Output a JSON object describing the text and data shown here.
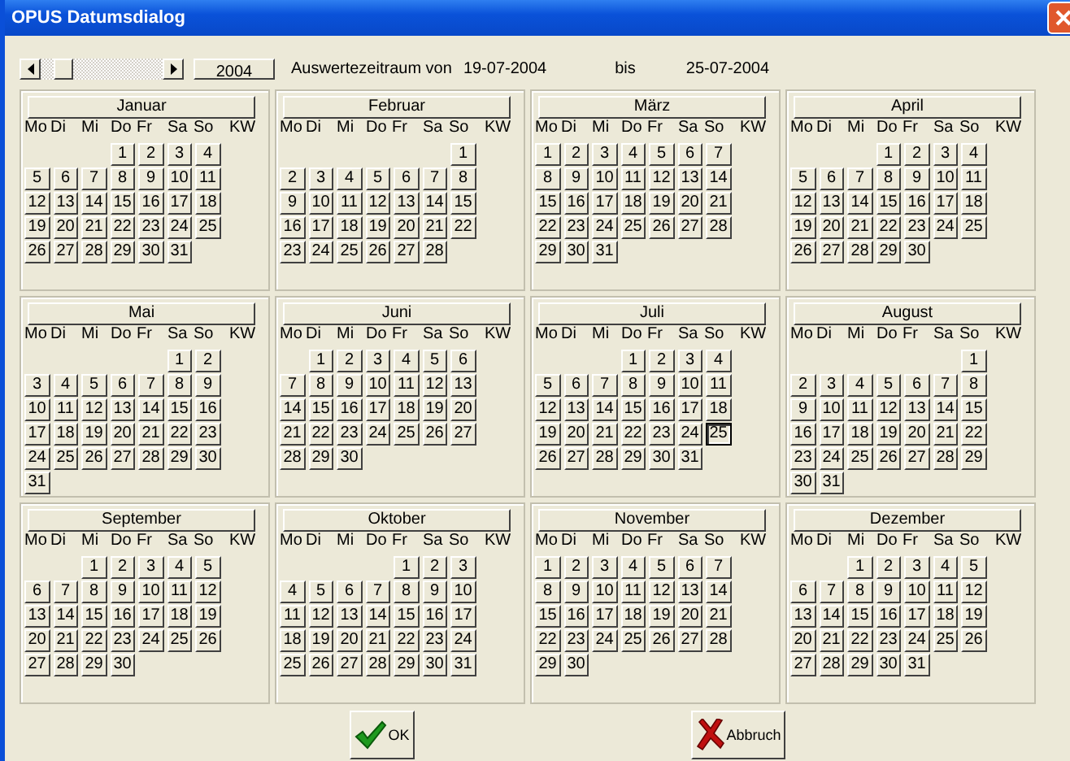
{
  "window": {
    "title": "OPUS Datumsdialog"
  },
  "year_button": "2004",
  "range": {
    "from_label": "Auswertezeitraum von",
    "from": "19-07-2004",
    "to_label": "bis",
    "to": "25-07-2004"
  },
  "months": [
    {
      "name": "Januar",
      "weekdays": [
        "Mo",
        "Di",
        "Mi",
        "Do",
        "Fr",
        "Sa",
        "So",
        "KW"
      ],
      "weeks": [
        [
          {
            "t": "1",
            "selected": false
          },
          {
            "t": "2",
            "selected": false
          },
          {
            "t": "3",
            "selected": false
          },
          {
            "t": "4",
            "selected": false
          }
        ],
        [
          {
            "t": "5",
            "selected": false
          },
          {
            "t": "6",
            "selected": false
          },
          {
            "t": "7",
            "selected": false
          },
          {
            "t": "8",
            "selected": false
          },
          {
            "t": "9",
            "selected": false
          },
          {
            "t": "10",
            "selected": false
          },
          {
            "t": "11",
            "selected": false
          }
        ],
        [
          {
            "t": "12",
            "selected": false
          },
          {
            "t": "13",
            "selected": false
          },
          {
            "t": "14",
            "selected": false
          },
          {
            "t": "15",
            "selected": false
          },
          {
            "t": "16",
            "selected": false
          },
          {
            "t": "17",
            "selected": false
          },
          {
            "t": "18",
            "selected": false
          }
        ],
        [
          {
            "t": "19",
            "selected": false
          },
          {
            "t": "20",
            "selected": false
          },
          {
            "t": "21",
            "selected": false
          },
          {
            "t": "22",
            "selected": false
          },
          {
            "t": "23",
            "selected": false
          },
          {
            "t": "24",
            "selected": false
          },
          {
            "t": "25",
            "selected": false
          }
        ],
        [
          {
            "t": "26",
            "selected": false
          },
          {
            "t": "27",
            "selected": false
          },
          {
            "t": "28",
            "selected": false
          },
          {
            "t": "29",
            "selected": false
          },
          {
            "t": "30",
            "selected": false
          },
          {
            "t": "31",
            "selected": false
          }
        ]
      ]
    },
    {
      "name": "Februar",
      "weekdays": [
        "Mo",
        "Di",
        "Mi",
        "Do",
        "Fr",
        "Sa",
        "So",
        "KW"
      ],
      "weeks": [
        [
          {
            "t": "1",
            "selected": false
          }
        ],
        [
          {
            "t": "2",
            "selected": false
          },
          {
            "t": "3",
            "selected": false
          },
          {
            "t": "4",
            "selected": false
          },
          {
            "t": "5",
            "selected": false
          },
          {
            "t": "6",
            "selected": false
          },
          {
            "t": "7",
            "selected": false
          },
          {
            "t": "8",
            "selected": false
          }
        ],
        [
          {
            "t": "9",
            "selected": false
          },
          {
            "t": "10",
            "selected": false
          },
          {
            "t": "11",
            "selected": false
          },
          {
            "t": "12",
            "selected": false
          },
          {
            "t": "13",
            "selected": false
          },
          {
            "t": "14",
            "selected": false
          },
          {
            "t": "15",
            "selected": false
          }
        ],
        [
          {
            "t": "16",
            "selected": false
          },
          {
            "t": "17",
            "selected": false
          },
          {
            "t": "18",
            "selected": false
          },
          {
            "t": "19",
            "selected": false
          },
          {
            "t": "20",
            "selected": false
          },
          {
            "t": "21",
            "selected": false
          },
          {
            "t": "22",
            "selected": false
          }
        ],
        [
          {
            "t": "23",
            "selected": false
          },
          {
            "t": "24",
            "selected": false
          },
          {
            "t": "25",
            "selected": false
          },
          {
            "t": "26",
            "selected": false
          },
          {
            "t": "27",
            "selected": false
          },
          {
            "t": "28",
            "selected": false
          }
        ]
      ]
    },
    {
      "name": "März",
      "weekdays": [
        "Mo",
        "Di",
        "Mi",
        "Do",
        "Fr",
        "Sa",
        "So",
        "KW"
      ],
      "weeks": [
        [
          {
            "t": "1",
            "selected": false
          },
          {
            "t": "2",
            "selected": false
          },
          {
            "t": "3",
            "selected": false
          },
          {
            "t": "4",
            "selected": false
          },
          {
            "t": "5",
            "selected": false
          },
          {
            "t": "6",
            "selected": false
          },
          {
            "t": "7",
            "selected": false
          }
        ],
        [
          {
            "t": "8",
            "selected": false
          },
          {
            "t": "9",
            "selected": false
          },
          {
            "t": "10",
            "selected": false
          },
          {
            "t": "11",
            "selected": false
          },
          {
            "t": "12",
            "selected": false
          },
          {
            "t": "13",
            "selected": false
          },
          {
            "t": "14",
            "selected": false
          }
        ],
        [
          {
            "t": "15",
            "selected": false
          },
          {
            "t": "16",
            "selected": false
          },
          {
            "t": "17",
            "selected": false
          },
          {
            "t": "18",
            "selected": false
          },
          {
            "t": "19",
            "selected": false
          },
          {
            "t": "20",
            "selected": false
          },
          {
            "t": "21",
            "selected": false
          }
        ],
        [
          {
            "t": "22",
            "selected": false
          },
          {
            "t": "23",
            "selected": false
          },
          {
            "t": "24",
            "selected": false
          },
          {
            "t": "25",
            "selected": false
          },
          {
            "t": "26",
            "selected": false
          },
          {
            "t": "27",
            "selected": false
          },
          {
            "t": "28",
            "selected": false
          }
        ],
        [
          {
            "t": "29",
            "selected": false
          },
          {
            "t": "30",
            "selected": false
          },
          {
            "t": "31",
            "selected": false
          }
        ]
      ]
    },
    {
      "name": "April",
      "weekdays": [
        "Mo",
        "Di",
        "Mi",
        "Do",
        "Fr",
        "Sa",
        "So",
        "KW"
      ],
      "weeks": [
        [
          {
            "t": "1",
            "selected": false
          },
          {
            "t": "2",
            "selected": false
          },
          {
            "t": "3",
            "selected": false
          },
          {
            "t": "4",
            "selected": false
          }
        ],
        [
          {
            "t": "5",
            "selected": false
          },
          {
            "t": "6",
            "selected": false
          },
          {
            "t": "7",
            "selected": false
          },
          {
            "t": "8",
            "selected": false
          },
          {
            "t": "9",
            "selected": false
          },
          {
            "t": "10",
            "selected": false
          },
          {
            "t": "11",
            "selected": false
          }
        ],
        [
          {
            "t": "12",
            "selected": false
          },
          {
            "t": "13",
            "selected": false
          },
          {
            "t": "14",
            "selected": false
          },
          {
            "t": "15",
            "selected": false
          },
          {
            "t": "16",
            "selected": false
          },
          {
            "t": "17",
            "selected": false
          },
          {
            "t": "18",
            "selected": false
          }
        ],
        [
          {
            "t": "19",
            "selected": false
          },
          {
            "t": "20",
            "selected": false
          },
          {
            "t": "21",
            "selected": false
          },
          {
            "t": "22",
            "selected": false
          },
          {
            "t": "23",
            "selected": false
          },
          {
            "t": "24",
            "selected": false
          },
          {
            "t": "25",
            "selected": false
          }
        ],
        [
          {
            "t": "26",
            "selected": false
          },
          {
            "t": "27",
            "selected": false
          },
          {
            "t": "28",
            "selected": false
          },
          {
            "t": "29",
            "selected": false
          },
          {
            "t": "30",
            "selected": false
          }
        ]
      ]
    },
    {
      "name": "Mai",
      "weekdays": [
        "Mo",
        "Di",
        "Mi",
        "Do",
        "Fr",
        "Sa",
        "So",
        "KW"
      ],
      "weeks": [
        [
          {
            "t": "1",
            "selected": false
          },
          {
            "t": "2",
            "selected": false
          }
        ],
        [
          {
            "t": "3",
            "selected": false
          },
          {
            "t": "4",
            "selected": false
          },
          {
            "t": "5",
            "selected": false
          },
          {
            "t": "6",
            "selected": false
          },
          {
            "t": "7",
            "selected": false
          },
          {
            "t": "8",
            "selected": false
          },
          {
            "t": "9",
            "selected": false
          }
        ],
        [
          {
            "t": "10",
            "selected": false
          },
          {
            "t": "11",
            "selected": false
          },
          {
            "t": "12",
            "selected": false
          },
          {
            "t": "13",
            "selected": false
          },
          {
            "t": "14",
            "selected": false
          },
          {
            "t": "15",
            "selected": false
          },
          {
            "t": "16",
            "selected": false
          }
        ],
        [
          {
            "t": "17",
            "selected": false
          },
          {
            "t": "18",
            "selected": false
          },
          {
            "t": "19",
            "selected": false
          },
          {
            "t": "20",
            "selected": false
          },
          {
            "t": "21",
            "selected": false
          },
          {
            "t": "22",
            "selected": false
          },
          {
            "t": "23",
            "selected": false
          }
        ],
        [
          {
            "t": "24",
            "selected": false
          },
          {
            "t": "25",
            "selected": false
          },
          {
            "t": "26",
            "selected": false
          },
          {
            "t": "27",
            "selected": false
          },
          {
            "t": "28",
            "selected": false
          },
          {
            "t": "29",
            "selected": false
          },
          {
            "t": "30",
            "selected": false
          }
        ],
        [
          {
            "t": "31",
            "selected": false
          }
        ]
      ]
    },
    {
      "name": "Juni",
      "weekdays": [
        "Mo",
        "Di",
        "Mi",
        "Do",
        "Fr",
        "Sa",
        "So",
        "KW"
      ],
      "weeks": [
        [
          {
            "t": "1",
            "selected": false
          },
          {
            "t": "2",
            "selected": false
          },
          {
            "t": "3",
            "selected": false
          },
          {
            "t": "4",
            "selected": false
          },
          {
            "t": "5",
            "selected": false
          },
          {
            "t": "6",
            "selected": false
          }
        ],
        [
          {
            "t": "7",
            "selected": false
          },
          {
            "t": "8",
            "selected": false
          },
          {
            "t": "9",
            "selected": false
          },
          {
            "t": "10",
            "selected": false
          },
          {
            "t": "11",
            "selected": false
          },
          {
            "t": "12",
            "selected": false
          },
          {
            "t": "13",
            "selected": false
          }
        ],
        [
          {
            "t": "14",
            "selected": false
          },
          {
            "t": "15",
            "selected": false
          },
          {
            "t": "16",
            "selected": false
          },
          {
            "t": "17",
            "selected": false
          },
          {
            "t": "18",
            "selected": false
          },
          {
            "t": "19",
            "selected": false
          },
          {
            "t": "20",
            "selected": false
          }
        ],
        [
          {
            "t": "21",
            "selected": false
          },
          {
            "t": "22",
            "selected": false
          },
          {
            "t": "23",
            "selected": false
          },
          {
            "t": "24",
            "selected": false
          },
          {
            "t": "25",
            "selected": false
          },
          {
            "t": "26",
            "selected": false
          },
          {
            "t": "27",
            "selected": false
          }
        ],
        [
          {
            "t": "28",
            "selected": false
          },
          {
            "t": "29",
            "selected": false
          },
          {
            "t": "30",
            "selected": false
          }
        ]
      ]
    },
    {
      "name": "Juli",
      "weekdays": [
        "Mo",
        "Di",
        "Mi",
        "Do",
        "Fr",
        "Sa",
        "So",
        "KW"
      ],
      "weeks": [
        [
          {
            "t": "1",
            "selected": false
          },
          {
            "t": "2",
            "selected": false
          },
          {
            "t": "3",
            "selected": false
          },
          {
            "t": "4",
            "selected": false
          }
        ],
        [
          {
            "t": "5",
            "selected": false
          },
          {
            "t": "6",
            "selected": false
          },
          {
            "t": "7",
            "selected": false
          },
          {
            "t": "8",
            "selected": false
          },
          {
            "t": "9",
            "selected": false
          },
          {
            "t": "10",
            "selected": false
          },
          {
            "t": "11",
            "selected": false
          }
        ],
        [
          {
            "t": "12",
            "selected": false
          },
          {
            "t": "13",
            "selected": false
          },
          {
            "t": "14",
            "selected": false
          },
          {
            "t": "15",
            "selected": false
          },
          {
            "t": "16",
            "selected": false
          },
          {
            "t": "17",
            "selected": false
          },
          {
            "t": "18",
            "selected": false
          }
        ],
        [
          {
            "t": "19",
            "selected": false
          },
          {
            "t": "20",
            "selected": false
          },
          {
            "t": "21",
            "selected": false
          },
          {
            "t": "22",
            "selected": false
          },
          {
            "t": "23",
            "selected": false
          },
          {
            "t": "24",
            "selected": false
          },
          {
            "t": "25",
            "selected": true
          }
        ],
        [
          {
            "t": "26",
            "selected": false
          },
          {
            "t": "27",
            "selected": false
          },
          {
            "t": "28",
            "selected": false
          },
          {
            "t": "29",
            "selected": false
          },
          {
            "t": "30",
            "selected": false
          },
          {
            "t": "31",
            "selected": false
          }
        ]
      ]
    },
    {
      "name": "August",
      "weekdays": [
        "Mo",
        "Di",
        "Mi",
        "Do",
        "Fr",
        "Sa",
        "So",
        "KW"
      ],
      "weeks": [
        [
          {
            "t": "1",
            "selected": false
          }
        ],
        [
          {
            "t": "2",
            "selected": false
          },
          {
            "t": "3",
            "selected": false
          },
          {
            "t": "4",
            "selected": false
          },
          {
            "t": "5",
            "selected": false
          },
          {
            "t": "6",
            "selected": false
          },
          {
            "t": "7",
            "selected": false
          },
          {
            "t": "8",
            "selected": false
          }
        ],
        [
          {
            "t": "9",
            "selected": false
          },
          {
            "t": "10",
            "selected": false
          },
          {
            "t": "11",
            "selected": false
          },
          {
            "t": "12",
            "selected": false
          },
          {
            "t": "13",
            "selected": false
          },
          {
            "t": "14",
            "selected": false
          },
          {
            "t": "15",
            "selected": false
          }
        ],
        [
          {
            "t": "16",
            "selected": false
          },
          {
            "t": "17",
            "selected": false
          },
          {
            "t": "18",
            "selected": false
          },
          {
            "t": "19",
            "selected": false
          },
          {
            "t": "20",
            "selected": false
          },
          {
            "t": "21",
            "selected": false
          },
          {
            "t": "22",
            "selected": false
          }
        ],
        [
          {
            "t": "23",
            "selected": false
          },
          {
            "t": "24",
            "selected": false
          },
          {
            "t": "25",
            "selected": false
          },
          {
            "t": "26",
            "selected": false
          },
          {
            "t": "27",
            "selected": false
          },
          {
            "t": "28",
            "selected": false
          },
          {
            "t": "29",
            "selected": false
          }
        ],
        [
          {
            "t": "30",
            "selected": false
          },
          {
            "t": "31",
            "selected": false
          }
        ]
      ]
    },
    {
      "name": "September",
      "weekdays": [
        "Mo",
        "Di",
        "Mi",
        "Do",
        "Fr",
        "Sa",
        "So",
        "KW"
      ],
      "weeks": [
        [
          {
            "t": "1",
            "selected": false
          },
          {
            "t": "2",
            "selected": false
          },
          {
            "t": "3",
            "selected": false
          },
          {
            "t": "4",
            "selected": false
          },
          {
            "t": "5",
            "selected": false
          }
        ],
        [
          {
            "t": "6",
            "selected": false
          },
          {
            "t": "7",
            "selected": false
          },
          {
            "t": "8",
            "selected": false
          },
          {
            "t": "9",
            "selected": false
          },
          {
            "t": "10",
            "selected": false
          },
          {
            "t": "11",
            "selected": false
          },
          {
            "t": "12",
            "selected": false
          }
        ],
        [
          {
            "t": "13",
            "selected": false
          },
          {
            "t": "14",
            "selected": false
          },
          {
            "t": "15",
            "selected": false
          },
          {
            "t": "16",
            "selected": false
          },
          {
            "t": "17",
            "selected": false
          },
          {
            "t": "18",
            "selected": false
          },
          {
            "t": "19",
            "selected": false
          }
        ],
        [
          {
            "t": "20",
            "selected": false
          },
          {
            "t": "21",
            "selected": false
          },
          {
            "t": "22",
            "selected": false
          },
          {
            "t": "23",
            "selected": false
          },
          {
            "t": "24",
            "selected": false
          },
          {
            "t": "25",
            "selected": false
          },
          {
            "t": "26",
            "selected": false
          }
        ],
        [
          {
            "t": "27",
            "selected": false
          },
          {
            "t": "28",
            "selected": false
          },
          {
            "t": "29",
            "selected": false
          },
          {
            "t": "30",
            "selected": false
          }
        ]
      ]
    },
    {
      "name": "Oktober",
      "weekdays": [
        "Mo",
        "Di",
        "Mi",
        "Do",
        "Fr",
        "Sa",
        "So",
        "KW"
      ],
      "weeks": [
        [
          {
            "t": "1",
            "selected": false
          },
          {
            "t": "2",
            "selected": false
          },
          {
            "t": "3",
            "selected": false
          }
        ],
        [
          {
            "t": "4",
            "selected": false
          },
          {
            "t": "5",
            "selected": false
          },
          {
            "t": "6",
            "selected": false
          },
          {
            "t": "7",
            "selected": false
          },
          {
            "t": "8",
            "selected": false
          },
          {
            "t": "9",
            "selected": false
          },
          {
            "t": "10",
            "selected": false
          }
        ],
        [
          {
            "t": "11",
            "selected": false
          },
          {
            "t": "12",
            "selected": false
          },
          {
            "t": "13",
            "selected": false
          },
          {
            "t": "14",
            "selected": false
          },
          {
            "t": "15",
            "selected": false
          },
          {
            "t": "16",
            "selected": false
          },
          {
            "t": "17",
            "selected": false
          }
        ],
        [
          {
            "t": "18",
            "selected": false
          },
          {
            "t": "19",
            "selected": false
          },
          {
            "t": "20",
            "selected": false
          },
          {
            "t": "21",
            "selected": false
          },
          {
            "t": "22",
            "selected": false
          },
          {
            "t": "23",
            "selected": false
          },
          {
            "t": "24",
            "selected": false
          }
        ],
        [
          {
            "t": "25",
            "selected": false
          },
          {
            "t": "26",
            "selected": false
          },
          {
            "t": "27",
            "selected": false
          },
          {
            "t": "28",
            "selected": false
          },
          {
            "t": "29",
            "selected": false
          },
          {
            "t": "30",
            "selected": false
          },
          {
            "t": "31",
            "selected": false
          }
        ]
      ]
    },
    {
      "name": "November",
      "weekdays": [
        "Mo",
        "Di",
        "Mi",
        "Do",
        "Fr",
        "Sa",
        "So",
        "KW"
      ],
      "weeks": [
        [
          {
            "t": "1",
            "selected": false
          },
          {
            "t": "2",
            "selected": false
          },
          {
            "t": "3",
            "selected": false
          },
          {
            "t": "4",
            "selected": false
          },
          {
            "t": "5",
            "selected": false
          },
          {
            "t": "6",
            "selected": false
          },
          {
            "t": "7",
            "selected": false
          }
        ],
        [
          {
            "t": "8",
            "selected": false
          },
          {
            "t": "9",
            "selected": false
          },
          {
            "t": "10",
            "selected": false
          },
          {
            "t": "11",
            "selected": false
          },
          {
            "t": "12",
            "selected": false
          },
          {
            "t": "13",
            "selected": false
          },
          {
            "t": "14",
            "selected": false
          }
        ],
        [
          {
            "t": "15",
            "selected": false
          },
          {
            "t": "16",
            "selected": false
          },
          {
            "t": "17",
            "selected": false
          },
          {
            "t": "18",
            "selected": false
          },
          {
            "t": "19",
            "selected": false
          },
          {
            "t": "20",
            "selected": false
          },
          {
            "t": "21",
            "selected": false
          }
        ],
        [
          {
            "t": "22",
            "selected": false
          },
          {
            "t": "23",
            "selected": false
          },
          {
            "t": "24",
            "selected": false
          },
          {
            "t": "25",
            "selected": false
          },
          {
            "t": "26",
            "selected": false
          },
          {
            "t": "27",
            "selected": false
          },
          {
            "t": "28",
            "selected": false
          }
        ],
        [
          {
            "t": "29",
            "selected": false
          },
          {
            "t": "30",
            "selected": false
          }
        ]
      ]
    },
    {
      "name": "Dezember",
      "weekdays": [
        "Mo",
        "Di",
        "Mi",
        "Do",
        "Fr",
        "Sa",
        "So",
        "KW"
      ],
      "weeks": [
        [
          {
            "t": "1",
            "selected": false
          },
          {
            "t": "2",
            "selected": false
          },
          {
            "t": "3",
            "selected": false
          },
          {
            "t": "4",
            "selected": false
          },
          {
            "t": "5",
            "selected": false
          }
        ],
        [
          {
            "t": "6",
            "selected": false
          },
          {
            "t": "7",
            "selected": false
          },
          {
            "t": "8",
            "selected": false
          },
          {
            "t": "9",
            "selected": false
          },
          {
            "t": "10",
            "selected": false
          },
          {
            "t": "11",
            "selected": false
          },
          {
            "t": "12",
            "selected": false
          }
        ],
        [
          {
            "t": "13",
            "selected": false
          },
          {
            "t": "14",
            "selected": false
          },
          {
            "t": "15",
            "selected": false
          },
          {
            "t": "16",
            "selected": false
          },
          {
            "t": "17",
            "selected": false
          },
          {
            "t": "18",
            "selected": false
          },
          {
            "t": "19",
            "selected": false
          }
        ],
        [
          {
            "t": "20",
            "selected": false
          },
          {
            "t": "21",
            "selected": false
          },
          {
            "t": "22",
            "selected": false
          },
          {
            "t": "23",
            "selected": false
          },
          {
            "t": "24",
            "selected": false
          },
          {
            "t": "25",
            "selected": false
          },
          {
            "t": "26",
            "selected": false
          }
        ],
        [
          {
            "t": "27",
            "selected": false
          },
          {
            "t": "28",
            "selected": false
          },
          {
            "t": "29",
            "selected": false
          },
          {
            "t": "30",
            "selected": false
          },
          {
            "t": "31",
            "selected": false
          }
        ]
      ]
    }
  ],
  "buttons": [
    {
      "kind": "ok",
      "label": "OK"
    },
    {
      "kind": "cancel",
      "label": "Abbruch"
    }
  ]
}
